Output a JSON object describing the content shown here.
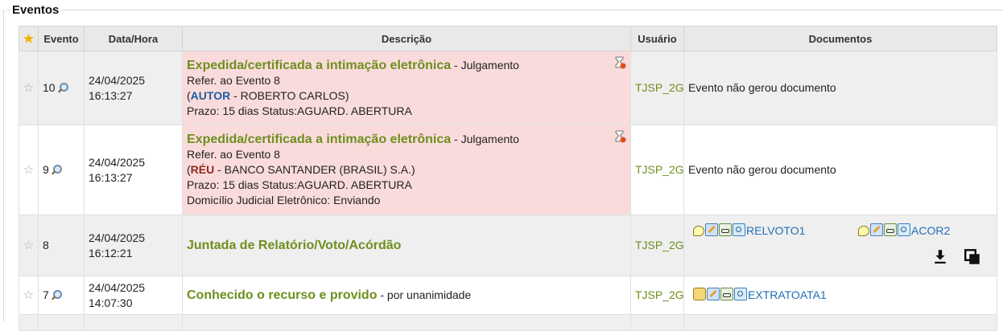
{
  "section": {
    "title": "Eventos"
  },
  "table": {
    "columns": {
      "evento": "Evento",
      "data": "Data/Hora",
      "descricao": "Descrição",
      "usuario": "Usuário",
      "documentos": "Documentos"
    },
    "rows": [
      {
        "evento": "10",
        "date": "24/04/2025",
        "time": "16:13:27",
        "title": "Expedida/certificada a intimação eletrônica",
        "title_suffix": " - Julgamento",
        "line_ref": "Refer. ao Evento 8",
        "open_paren": "(",
        "role": "AUTOR",
        "party": " - ROBERTO CARLOS)",
        "prazo": "Prazo: 15 dias Status:AGUARD. ABERTURA",
        "user": "TJSP_2G",
        "docs": "Evento não gerou documento"
      },
      {
        "evento": "9",
        "date": "24/04/2025",
        "time": "16:13:27",
        "title": "Expedida/certificada a intimação eletrônica",
        "title_suffix": " - Julgamento",
        "line_ref": "Refer. ao Evento 8",
        "open_paren": "(",
        "role": "RÉU",
        "party": " - BANCO SANTANDER (BRASIL) S.A.)",
        "prazo": "Prazo: 15 dias Status:AGUARD. ABERTURA",
        "domicilio": "Domicílio Judicial Eletrônico: Enviando",
        "user": "TJSP_2G",
        "docs": "Evento não gerou documento"
      },
      {
        "evento": "8",
        "date": "24/04/2025",
        "time": "16:12:21",
        "title": "Juntada de Relatório/Voto/Acórdão",
        "user": "TJSP_2G",
        "doc1": "RELVOTO1",
        "doc2": "ACOR2"
      },
      {
        "evento": "7",
        "date": "24/04/2025",
        "time": "14:07:30",
        "title": "Conhecido o recurso e provido",
        "title_suffix": " - por unanimidade",
        "user": "TJSP_2G",
        "doc1": "EXTRATOATA1"
      }
    ]
  },
  "icons": {
    "favorite": "star-icon",
    "search": "magnifier-icon",
    "hourglass": "hourglass-icon",
    "download": "download-icon",
    "copy": "copy-icon"
  },
  "colors": {
    "title": "#6e8f1e",
    "link": "#1f6fb4",
    "highlight": "#fadbdc",
    "header": "#e9e9e9"
  }
}
